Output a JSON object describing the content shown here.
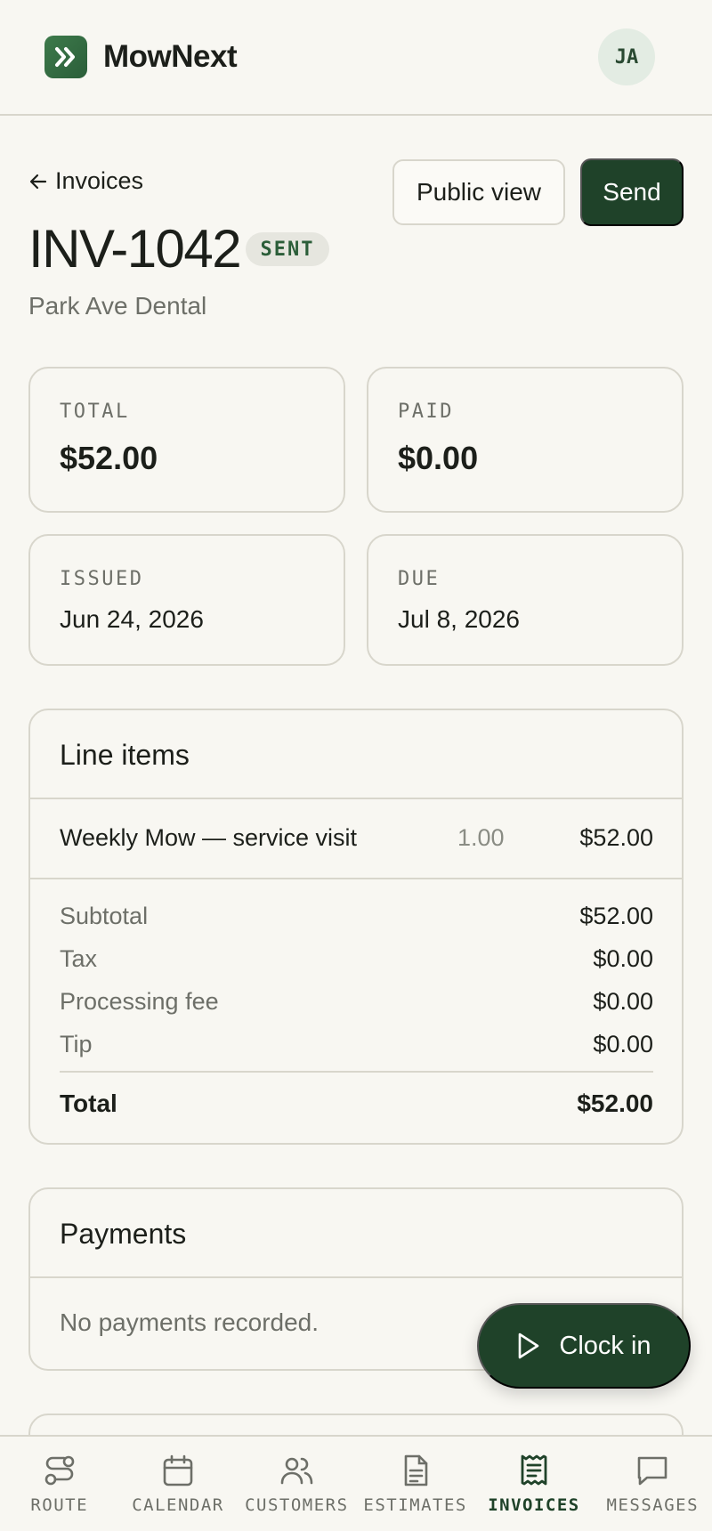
{
  "app": {
    "name": "MowNext",
    "user_initials": "JA"
  },
  "nav": {
    "back_label": "Invoices"
  },
  "actions": {
    "public_view": "Public view",
    "send": "Send"
  },
  "invoice": {
    "number": "INV-1042",
    "status": "SENT",
    "customer": "Park Ave Dental"
  },
  "stats": {
    "total": {
      "label": "TOTAL",
      "value": "$52.00"
    },
    "paid": {
      "label": "PAID",
      "value": "$0.00"
    },
    "issued": {
      "label": "ISSUED",
      "value": "Jun 24, 2026"
    },
    "due": {
      "label": "DUE",
      "value": "Jul 8, 2026"
    }
  },
  "line_items": {
    "title": "Line items",
    "items": [
      {
        "name": "Weekly Mow — service visit",
        "qty": "1.00",
        "amount": "$52.00"
      }
    ],
    "summary": [
      {
        "label": "Subtotal",
        "value": "$52.00"
      },
      {
        "label": "Tax",
        "value": "$0.00"
      },
      {
        "label": "Processing fee",
        "value": "$0.00"
      },
      {
        "label": "Tip",
        "value": "$0.00"
      }
    ],
    "total": {
      "label": "Total",
      "value": "$52.00"
    }
  },
  "payments": {
    "title": "Payments",
    "empty": "No payments recorded."
  },
  "fab": {
    "label": "Clock in"
  },
  "bottom_nav": [
    {
      "label": "ROUTE",
      "icon": "route-icon",
      "active": false
    },
    {
      "label": "CALENDAR",
      "icon": "calendar-icon",
      "active": false
    },
    {
      "label": "CUSTOMERS",
      "icon": "users-icon",
      "active": false
    },
    {
      "label": "ESTIMATES",
      "icon": "document-icon",
      "active": false
    },
    {
      "label": "INVOICES",
      "icon": "receipt-icon",
      "active": true
    },
    {
      "label": "MESSAGES",
      "icon": "message-icon",
      "active": false
    }
  ],
  "colors": {
    "accent": "#1f4229",
    "brand": "#2b5e39",
    "background": "#f8f7f2",
    "border": "#d8d6cc"
  }
}
